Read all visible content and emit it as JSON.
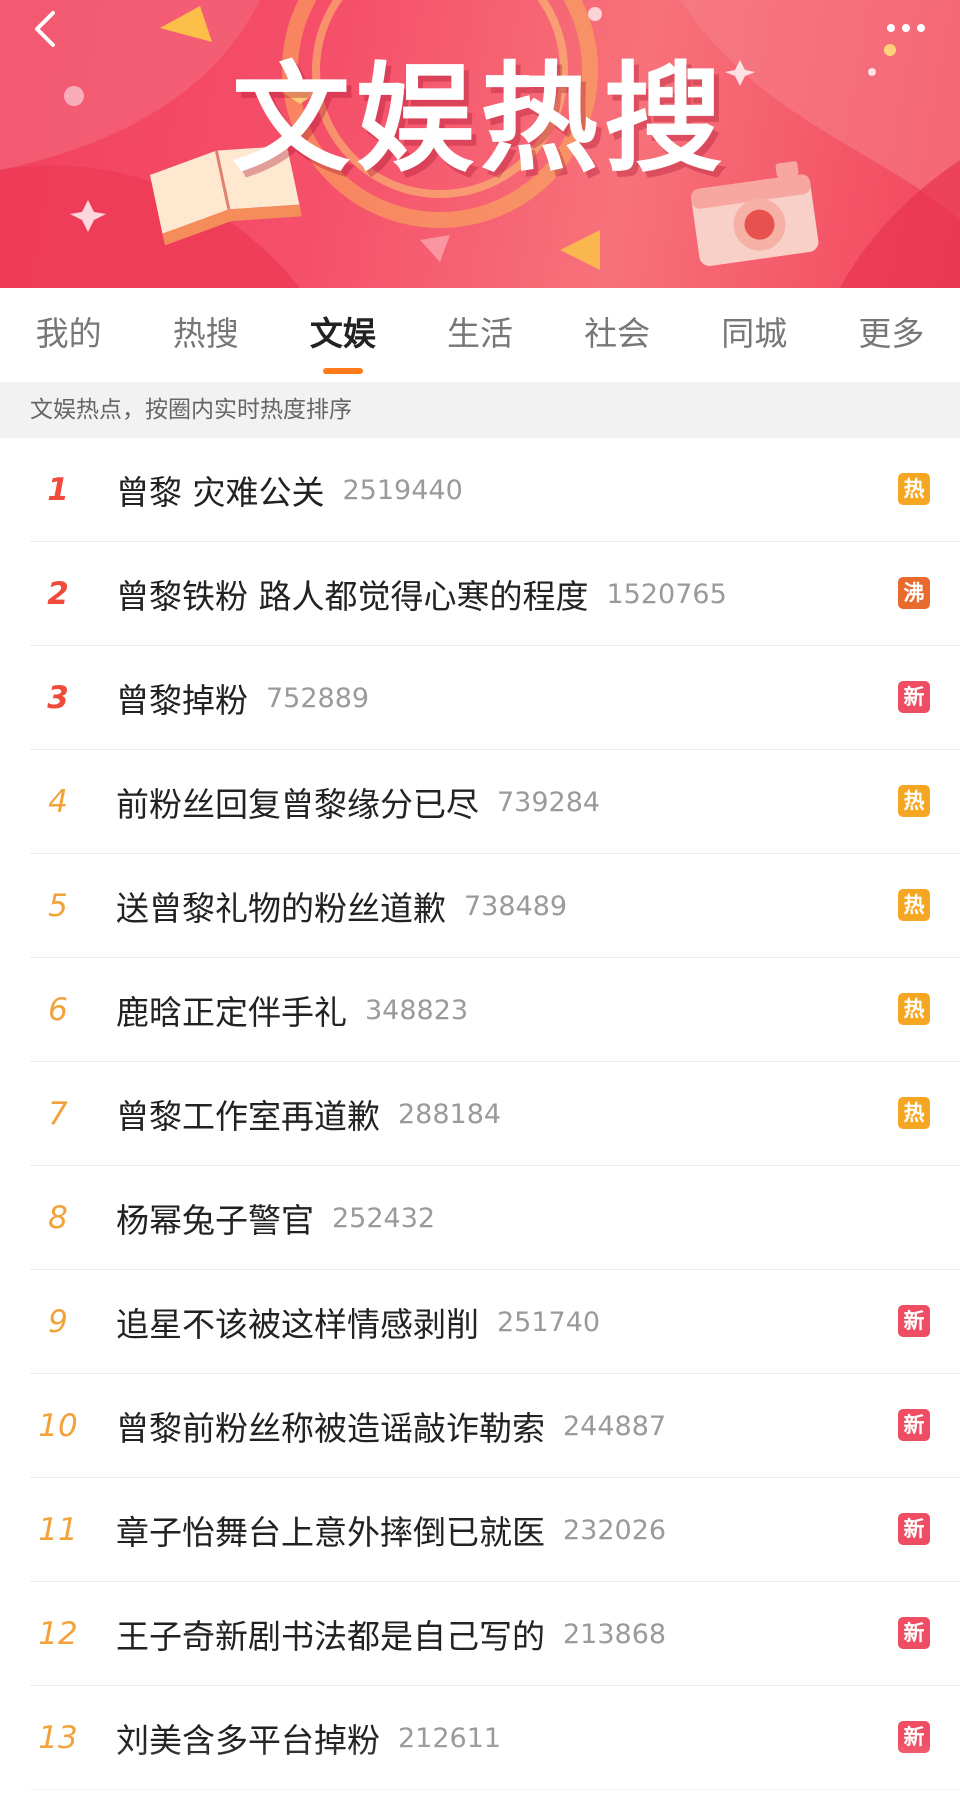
{
  "header": {
    "title": "文娱热搜",
    "back_icon": "chevron-left-icon",
    "more_icon": "more-dots-icon"
  },
  "tabs": [
    {
      "label": "我的",
      "active": false
    },
    {
      "label": "热搜",
      "active": false
    },
    {
      "label": "文娱",
      "active": true
    },
    {
      "label": "生活",
      "active": false
    },
    {
      "label": "社会",
      "active": false
    },
    {
      "label": "同城",
      "active": false
    },
    {
      "label": "更多",
      "active": false
    }
  ],
  "subtitle": "文娱热点，按圈内实时热度排序",
  "colors": {
    "banner": "#f2415e",
    "accent": "#ff7a1a",
    "rank_top": "#ef4a3a",
    "rank_other": "#f2a23a",
    "badge_hot": "#f5a623",
    "badge_boil": "#e86a2c",
    "badge_new": "#ee4d62"
  },
  "list": [
    {
      "rank": "1",
      "title": "曾黎 灾难公关",
      "count": "2519440",
      "badge": "热",
      "badge_type": "hot"
    },
    {
      "rank": "2",
      "title": "曾黎铁粉 路人都觉得心寒的程度",
      "count": "1520765",
      "badge": "沸",
      "badge_type": "boil"
    },
    {
      "rank": "3",
      "title": "曾黎掉粉",
      "count": "752889",
      "badge": "新",
      "badge_type": "new"
    },
    {
      "rank": "4",
      "title": "前粉丝回复曾黎缘分已尽",
      "count": "739284",
      "badge": "热",
      "badge_type": "hot"
    },
    {
      "rank": "5",
      "title": "送曾黎礼物的粉丝道歉",
      "count": "738489",
      "badge": "热",
      "badge_type": "hot"
    },
    {
      "rank": "6",
      "title": "鹿晗正定伴手礼",
      "count": "348823",
      "badge": "热",
      "badge_type": "hot"
    },
    {
      "rank": "7",
      "title": "曾黎工作室再道歉",
      "count": "288184",
      "badge": "热",
      "badge_type": "hot"
    },
    {
      "rank": "8",
      "title": "杨幂兔子警官",
      "count": "252432",
      "badge": "",
      "badge_type": "none"
    },
    {
      "rank": "9",
      "title": "追星不该被这样情感剥削",
      "count": "251740",
      "badge": "新",
      "badge_type": "new"
    },
    {
      "rank": "10",
      "title": "曾黎前粉丝称被造谣敲诈勒索",
      "count": "244887",
      "badge": "新",
      "badge_type": "new"
    },
    {
      "rank": "11",
      "title": "章子怡舞台上意外摔倒已就医",
      "count": "232026",
      "badge": "新",
      "badge_type": "new"
    },
    {
      "rank": "12",
      "title": "王子奇新剧书法都是自己写的",
      "count": "213868",
      "badge": "新",
      "badge_type": "new"
    },
    {
      "rank": "13",
      "title": "刘美含多平台掉粉",
      "count": "212611",
      "badge": "新",
      "badge_type": "new"
    }
  ]
}
